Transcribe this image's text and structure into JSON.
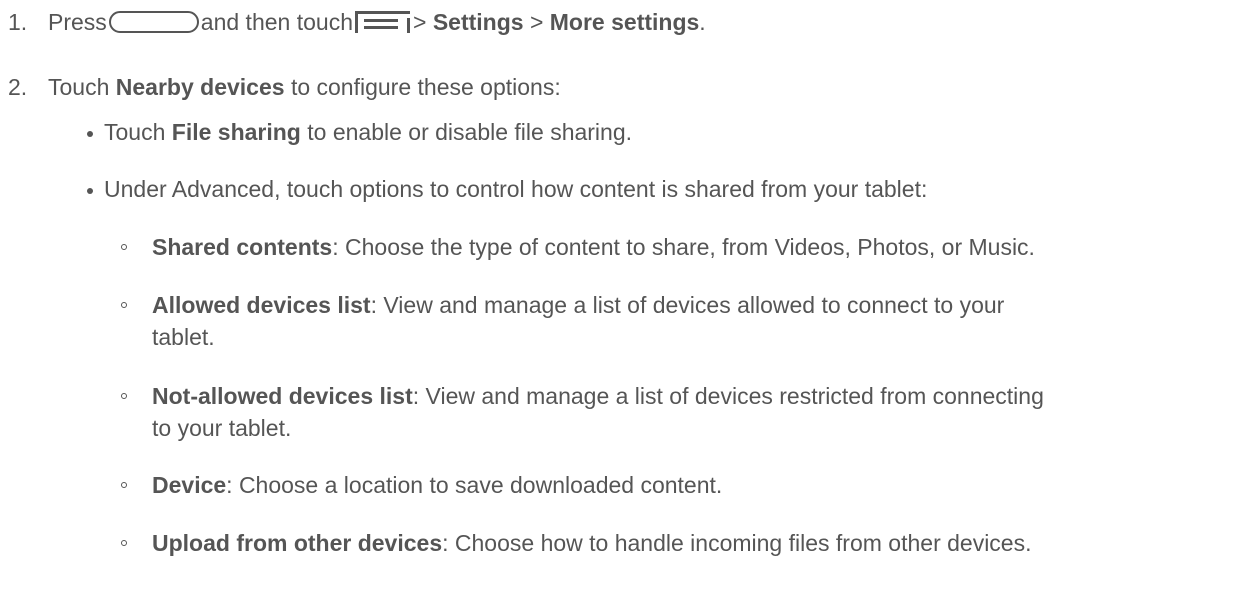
{
  "steps": [
    {
      "number": "1.",
      "press": "Press",
      "then": "and then touch",
      "sep1": ">",
      "settings": "Settings",
      "sep2": ">",
      "more_settings": "More settings",
      "end": "."
    },
    {
      "number": "2.",
      "touch": "Touch",
      "nearby": "Nearby devices",
      "rest": "to configure these options:"
    }
  ],
  "bullets": [
    {
      "touch": "Touch",
      "bold": "File sharing",
      "rest": "to enable or disable file sharing."
    },
    {
      "text": "Under Advanced, touch options to control how content is shared from your tablet:"
    }
  ],
  "sub_items": [
    {
      "bold": "Shared contents",
      "rest": ": Choose the type of content to share, from Videos, Photos, or Music."
    },
    {
      "bold": "Allowed devices list",
      "rest": ": View and manage a list of devices allowed to connect to your",
      "cont": "tablet."
    },
    {
      "bold": "Not-allowed devices list",
      "rest": ": View and manage a list of devices restricted from connecting",
      "cont": "to your tablet."
    },
    {
      "bold": "Device",
      "rest": ": Choose a location to save downloaded content."
    },
    {
      "bold": "Upload from other devices",
      "rest": ": Choose how to handle incoming files from other devices."
    }
  ],
  "icons": {
    "home_key": "home-key-icon",
    "menu_key": "menu-key-icon"
  },
  "colors": {
    "text": "#555555",
    "background": "#ffffff"
  }
}
